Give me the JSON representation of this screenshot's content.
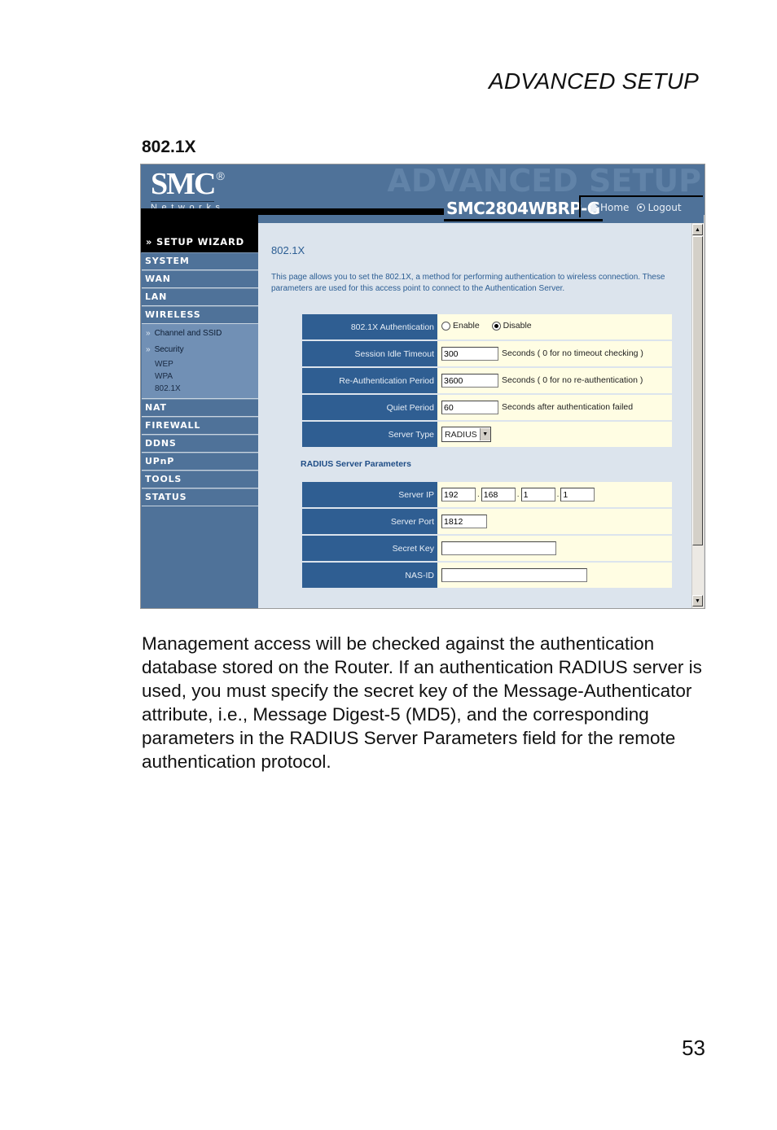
{
  "running_head": "ADVANCED SETUP",
  "section_title": "802.1X",
  "screenshot": {
    "header": {
      "logo_text": "SMC",
      "logo_registered": "®",
      "logo_subtext": "Networks",
      "watermark": "ADVANCED SETUP",
      "model": "SMC2804WBRP-G",
      "home_label": "Home",
      "logout_label": "Logout"
    },
    "sidebar": {
      "setup_wizard": "» SETUP WIZARD",
      "items_top": [
        "SYSTEM",
        "WAN",
        "LAN",
        "WIRELESS"
      ],
      "wireless_sub": [
        {
          "label": "Channel and SSID",
          "bullet": "»"
        },
        {
          "label": "Security",
          "bullet": "»"
        }
      ],
      "security_sub": [
        "WEP",
        "WPA",
        "802.1X"
      ],
      "items_bottom": [
        "NAT",
        "FIREWALL",
        "DDNS",
        "UPnP",
        "TOOLS",
        "STATUS"
      ]
    },
    "content": {
      "title": "802.1X",
      "description": "This page allows you to set the 802.1X, a method for performing authentication to wireless connection.  These parameters are used for this access point to connect to the Authentication Server.",
      "auth": {
        "label": "802.1X Authentication",
        "options": [
          "Enable",
          "Disable"
        ],
        "selected": "Disable"
      },
      "session_idle_timeout": {
        "label": "Session Idle Timeout",
        "value": "300",
        "note": "Seconds ( 0 for no timeout checking )"
      },
      "reauth_period": {
        "label": "Re-Authentication Period",
        "value": "3600",
        "note": "Seconds ( 0 for no re-authentication )"
      },
      "quiet_period": {
        "label": "Quiet Period",
        "value": "60",
        "note": "Seconds after authentication failed"
      },
      "server_type": {
        "label": "Server Type",
        "value": "RADIUS"
      },
      "radius_heading": "RADIUS Server Parameters",
      "server_ip": {
        "label": "Server IP",
        "octets": [
          "192",
          "168",
          "1",
          "1"
        ],
        "separator": "."
      },
      "server_port": {
        "label": "Server Port",
        "value": "1812"
      },
      "secret_key": {
        "label": "Secret Key",
        "value": ""
      },
      "nas_id": {
        "label": "NAS-ID",
        "value": ""
      }
    },
    "scrollbar": {
      "up": "▲",
      "down": "▼"
    }
  },
  "body_text": "Management access will be checked against the authentication database stored on the Router. If an authentication RADIUS server is used, you must specify the secret key of the Message-Authenticator attribute, i.e., Message Digest-5 (MD5), and the corresponding parameters in the RADIUS Server Parameters field for the remote authentication protocol.",
  "page_number": "53"
}
